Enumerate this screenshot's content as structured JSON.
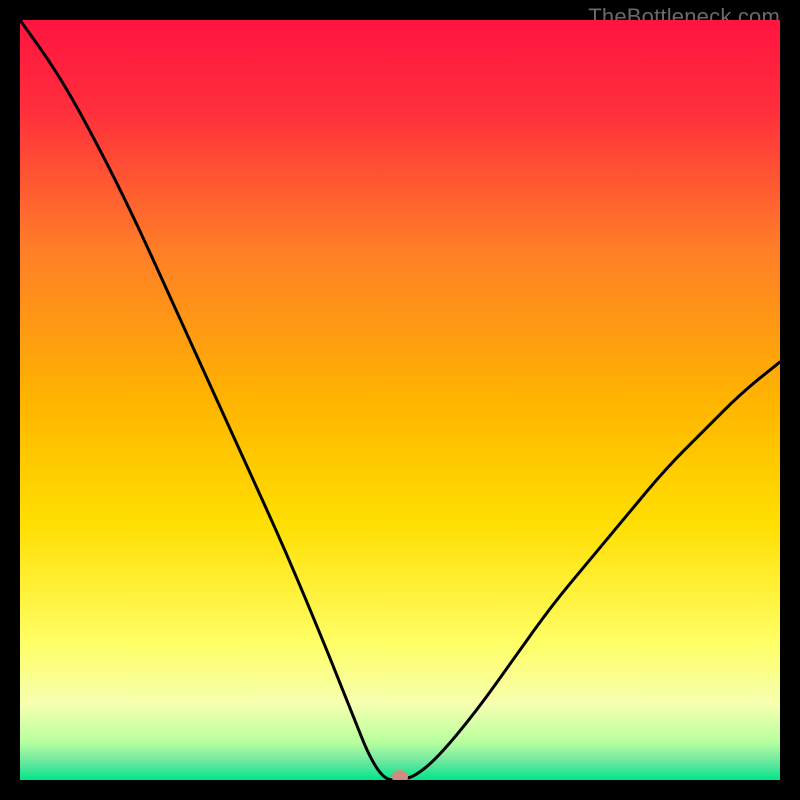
{
  "watermark": "TheBottleneck.com",
  "chart_data": {
    "type": "line",
    "title": "",
    "xlabel": "",
    "ylabel": "",
    "xlim": [
      0,
      100
    ],
    "ylim": [
      0,
      100
    ],
    "x": [
      0,
      5,
      10,
      15,
      20,
      25,
      30,
      35,
      40,
      42,
      44,
      46,
      48,
      50,
      52,
      55,
      60,
      65,
      70,
      75,
      80,
      85,
      90,
      95,
      100
    ],
    "values": [
      100,
      93,
      84,
      74,
      63,
      52,
      41,
      30,
      18,
      13,
      8,
      3,
      0,
      0,
      0.5,
      3,
      9,
      16,
      23,
      29,
      35,
      41,
      46,
      51,
      55
    ],
    "marker": {
      "x": 50,
      "y": 0
    },
    "colors": {
      "top": "#ff1440",
      "mid": "#ffde00",
      "bottom1": "#f6ffb0",
      "bottom2": "#b8ff9e",
      "bottom3": "#00e58a",
      "curve": "#000000",
      "marker": "#cf8d7f"
    }
  }
}
